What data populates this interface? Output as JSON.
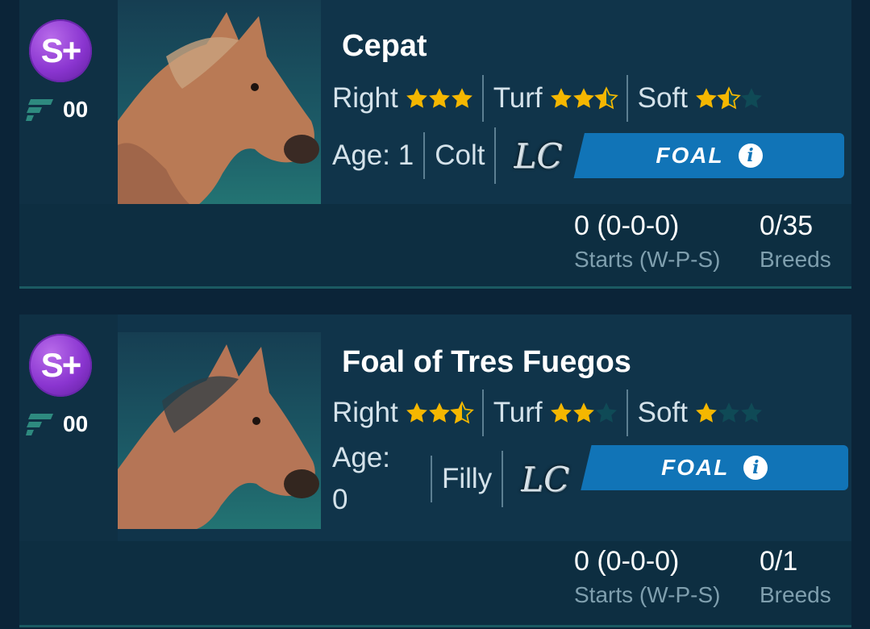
{
  "horses": [
    {
      "badge": "S+",
      "rank": "00",
      "name": "Cepat",
      "direction": {
        "label": "Right",
        "stars": 3
      },
      "surface": {
        "label": "Turf",
        "stars": 2.5
      },
      "condition": {
        "label": "Soft",
        "stars": 1.5
      },
      "age": "Age: 1",
      "sex": "Colt",
      "lc": "LC",
      "status": "FOAL",
      "starts_value": "0 (0-0-0)",
      "starts_caption": "Starts (W-P-S)",
      "breeds_value": "0/35",
      "breeds_caption": "Breeds"
    },
    {
      "badge": "S+",
      "rank": "00",
      "name": "Foal of Tres Fuegos",
      "direction": {
        "label": "Right",
        "stars": 2.5
      },
      "surface": {
        "label": "Turf",
        "stars": 2
      },
      "condition": {
        "label": "Soft",
        "stars": 1
      },
      "age_line1": "Age:",
      "age_line2": "0",
      "sex": "Filly",
      "lc": "LC",
      "status": "FOAL",
      "starts_value": "0 (0-0-0)",
      "starts_caption": "Starts (W-P-S)",
      "breeds_value": "0/1",
      "breeds_caption": "Breeds"
    }
  ],
  "colors": {
    "star_filled": "#f5b700",
    "star_empty": "#0f4a56",
    "foal_button": "#1174b7",
    "badge": "#8a35d0"
  },
  "icons": [
    "s-plus-badge",
    "rank-icon",
    "star-icon",
    "lc-logo",
    "info-icon"
  ]
}
